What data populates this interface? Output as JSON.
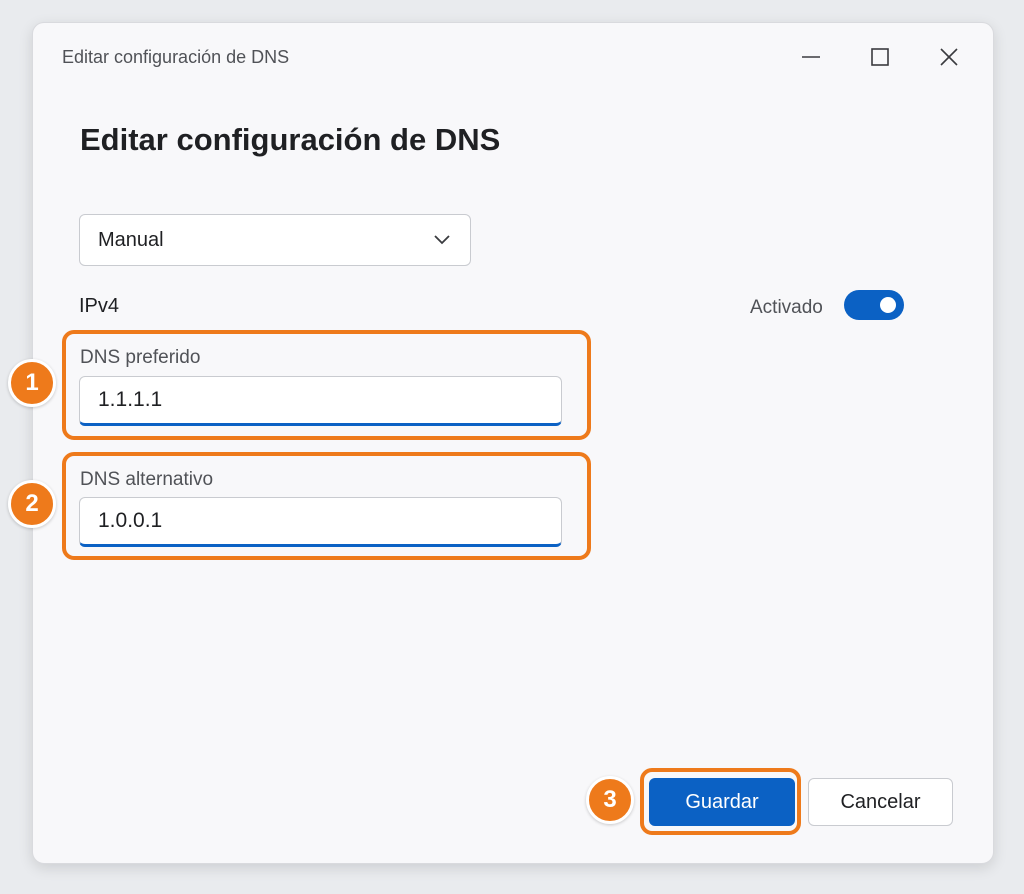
{
  "window": {
    "title": "Editar configuración de DNS"
  },
  "main": {
    "heading": "Editar configuración de DNS",
    "mode_select": {
      "selected": "Manual",
      "chevron_icon": "chevron-down-icon"
    },
    "ipv4": {
      "label": "IPv4",
      "toggle_label": "Activado",
      "toggle_on": true
    },
    "preferred_dns": {
      "label": "DNS preferido",
      "value": "1.1.1.1"
    },
    "alternate_dns": {
      "label": "DNS alternativo",
      "value": "1.0.0.1"
    }
  },
  "footer": {
    "save_label": "Guardar",
    "cancel_label": "Cancelar"
  },
  "annotations": {
    "step_1": "1",
    "step_2": "2",
    "step_3": "3"
  },
  "colors": {
    "accent": "#0b61c4",
    "highlight": "#ee7a1b"
  }
}
